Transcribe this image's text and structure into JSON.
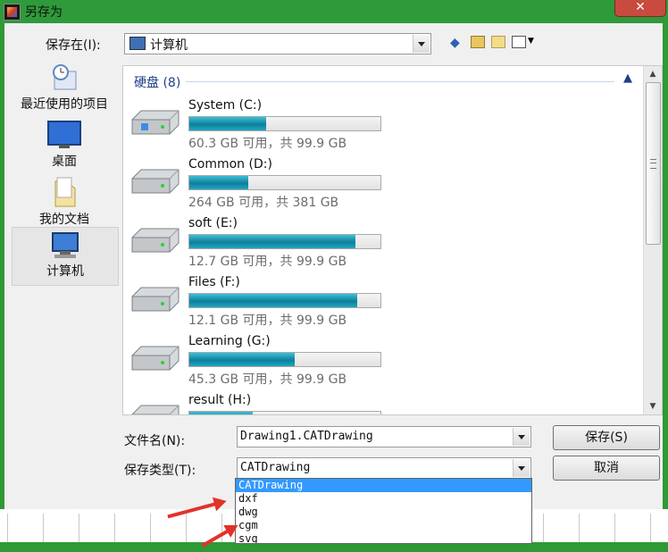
{
  "window": {
    "title": "另存为",
    "close_glyph": "✕"
  },
  "location_bar": {
    "label": "保存在(I):",
    "value": "计算机"
  },
  "places": [
    {
      "label": "最近使用的项目",
      "icon": "recent-items-icon"
    },
    {
      "label": "桌面",
      "icon": "desktop-icon"
    },
    {
      "label": "我的文档",
      "icon": "documents-folder-icon"
    },
    {
      "label": "计算机",
      "icon": "computer-icon",
      "selected": true
    }
  ],
  "file_view": {
    "group_header": "硬盘 (8)",
    "drives": [
      {
        "name": "System (C:)",
        "info": "60.3 GB 可用，共 99.9 GB",
        "used_fraction": 0.4
      },
      {
        "name": "Common (D:)",
        "info": "264 GB 可用，共 381 GB",
        "used_fraction": 0.31
      },
      {
        "name": "soft (E:)",
        "info": "12.7 GB 可用，共 99.9 GB",
        "used_fraction": 0.87
      },
      {
        "name": "Files (F:)",
        "info": "12.1 GB 可用，共 99.9 GB",
        "used_fraction": 0.88
      },
      {
        "name": "Learning (G:)",
        "info": "45.3 GB 可用，共 99.9 GB",
        "used_fraction": 0.55
      },
      {
        "name": "result (H:)",
        "info": "",
        "used_fraction": 0.33
      }
    ]
  },
  "filename": {
    "label": "文件名(N):",
    "value": "Drawing1.CATDrawing"
  },
  "filetype": {
    "label": "保存类型(T):",
    "value": "CATDrawing",
    "options": [
      "CATDrawing",
      "dxf",
      "dwg",
      "cgm",
      "svg"
    ],
    "selected_index": 0
  },
  "buttons": {
    "save": "保存(S)",
    "cancel": "取消"
  },
  "colors": {
    "title_bar": "#2f9a3a",
    "selection": "#3399ff",
    "annotation_arrow": "#e2322a",
    "progress": "#1ea8c2"
  }
}
